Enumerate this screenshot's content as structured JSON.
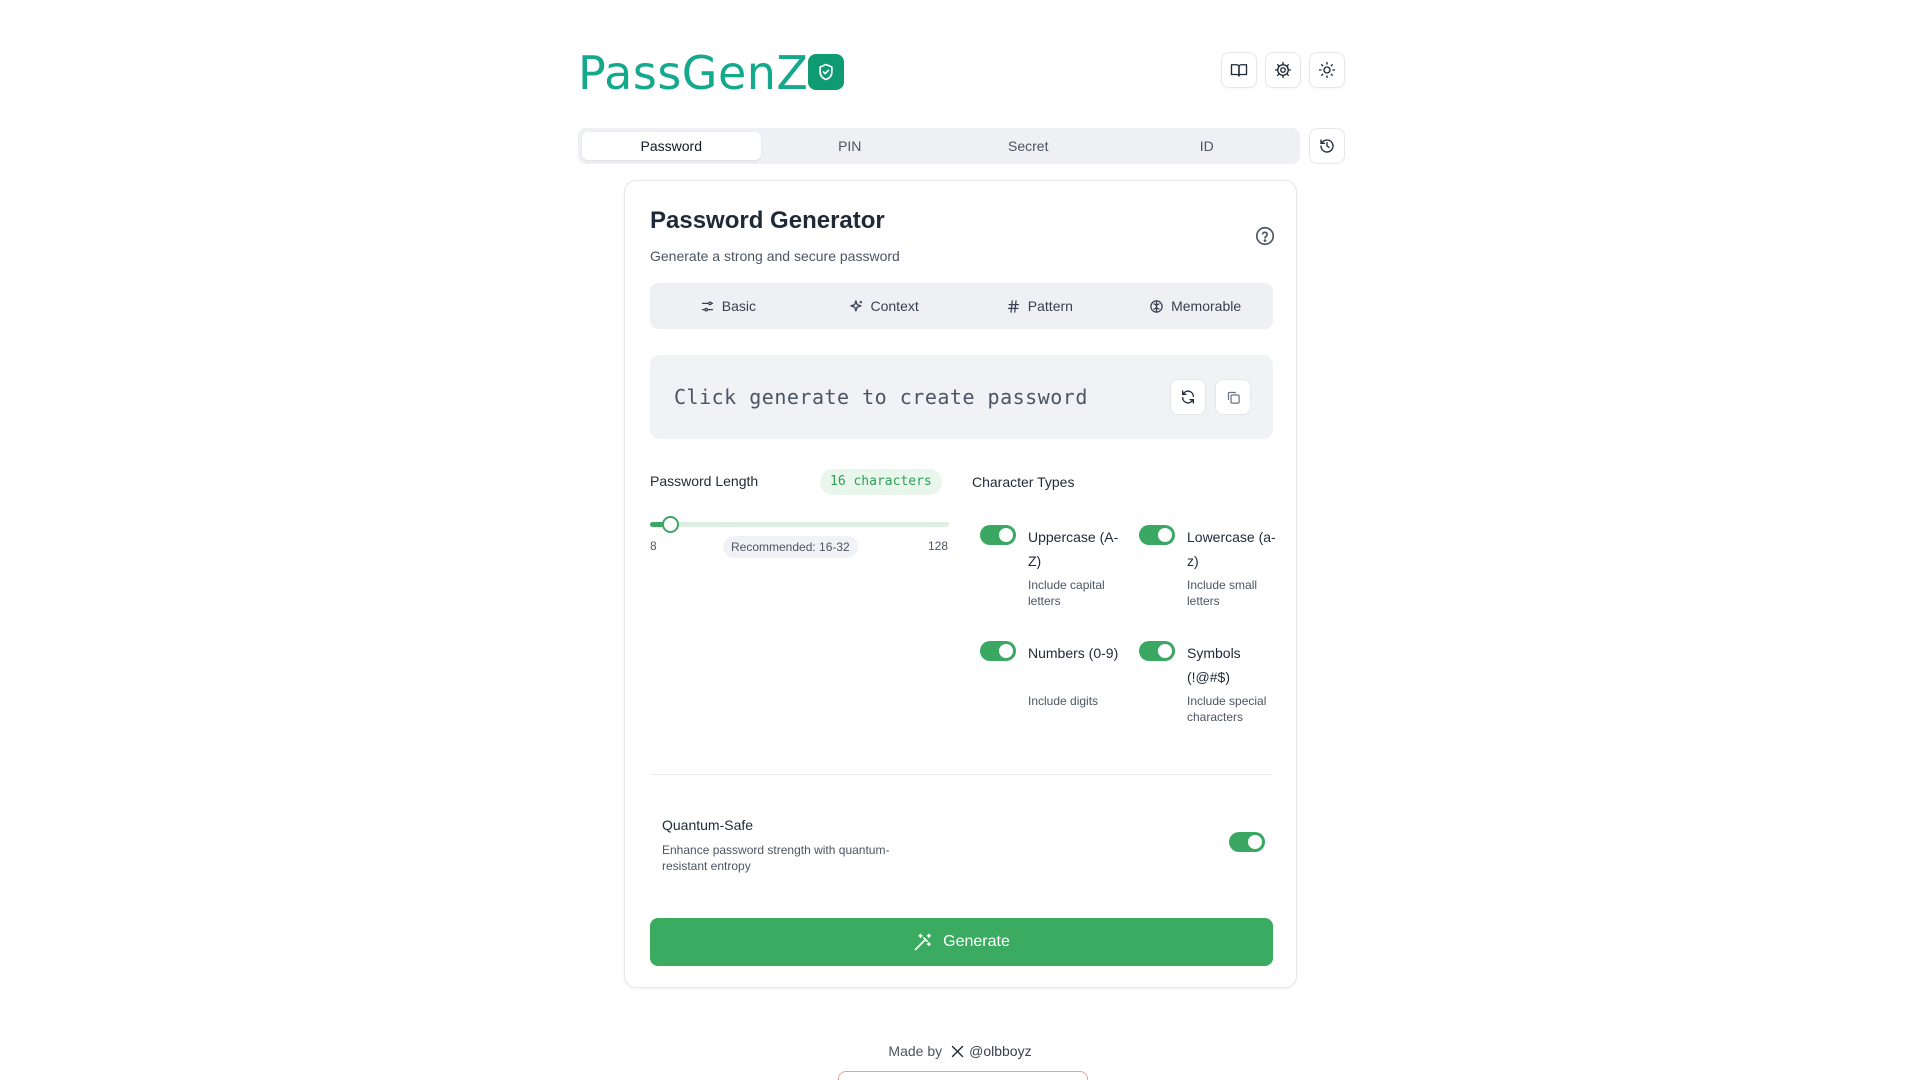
{
  "app": {
    "logo_text": "PassGenZ",
    "brand_color": "#14a88c",
    "accent_color": "#3aab60",
    "header_buttons": [
      "book-icon",
      "gear-icon",
      "sun-icon"
    ]
  },
  "tabs": [
    {
      "label": "Password",
      "active": true
    },
    {
      "label": "PIN",
      "active": false
    },
    {
      "label": "Secret",
      "active": false
    },
    {
      "label": "ID",
      "active": false
    }
  ],
  "card": {
    "title": "Password Generator",
    "subtitle": "Generate a strong and secure password",
    "modes": [
      {
        "label": "Basic",
        "icon": "sliders-icon"
      },
      {
        "label": "Context",
        "icon": "sparkles-icon"
      },
      {
        "label": "Pattern",
        "icon": "hash-icon"
      },
      {
        "label": "Memorable",
        "icon": "brain-icon"
      }
    ],
    "output_placeholder": "Click generate to create password",
    "length": {
      "label": "Password Length",
      "badge": "16 characters",
      "value": 16,
      "min_label": "8",
      "max_label": "128",
      "min": 8,
      "max": 128,
      "recommended": "Recommended: 16-32"
    },
    "char_types": {
      "title": "Character Types",
      "items": [
        {
          "name": "Uppercase (A-Z)",
          "desc": "Include capital letters",
          "enabled": true
        },
        {
          "name": "Lowercase (a-z)",
          "desc": "Include small letters",
          "enabled": true
        },
        {
          "name": "Numbers (0-9)",
          "desc": "Include digits",
          "enabled": true
        },
        {
          "name": "Symbols (!@#$)",
          "desc": "Include special characters",
          "enabled": true
        }
      ]
    },
    "quantum": {
      "title": "Quantum-Safe",
      "desc": "Enhance password strength with quantum-resistant entropy",
      "enabled": true
    },
    "generate_label": "Generate"
  },
  "footer": {
    "made_by": "Made by",
    "handle": "@olbboyz"
  }
}
